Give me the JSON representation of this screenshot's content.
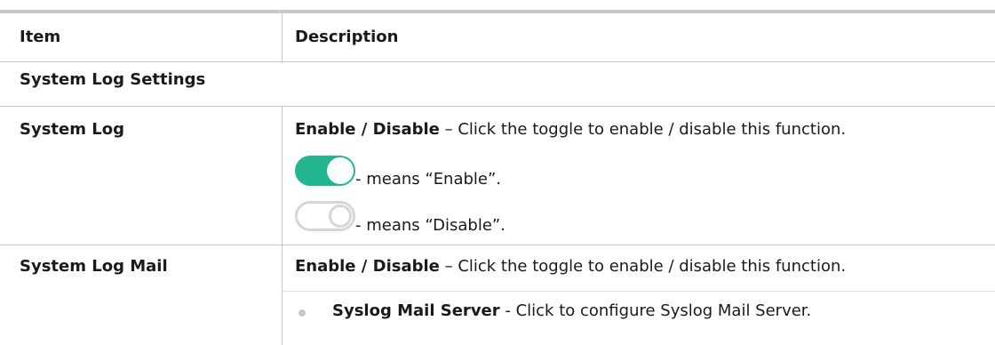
{
  "table": {
    "headers": {
      "item": "Item",
      "description": "Description"
    },
    "section_title": "System Log Settings",
    "rows": [
      {
        "item": "System Log",
        "desc_bold": "Enable / Disable",
        "desc_rest": " – Click the toggle to enable / disable this function.",
        "toggles": [
          {
            "state": "on",
            "text": "- means “Enable”."
          },
          {
            "state": "off",
            "text": "- means “Disable”."
          }
        ]
      },
      {
        "item": "System Log Mail",
        "desc_bold": "Enable / Disable",
        "desc_rest": " – Click the toggle to enable / disable this function.",
        "bullets": [
          {
            "bold": "Syslog Mail Server",
            "rest": " - Click to configure Syslog Mail Server."
          }
        ]
      }
    ]
  },
  "colors": {
    "toggle_on": "#22b58f",
    "toggle_off_border": "#d6d6d6",
    "rule": "#c8c8c8"
  },
  "icons": {
    "toggle_on": "toggle-on-icon",
    "toggle_off": "toggle-off-icon",
    "bullet": "bullet-icon"
  }
}
